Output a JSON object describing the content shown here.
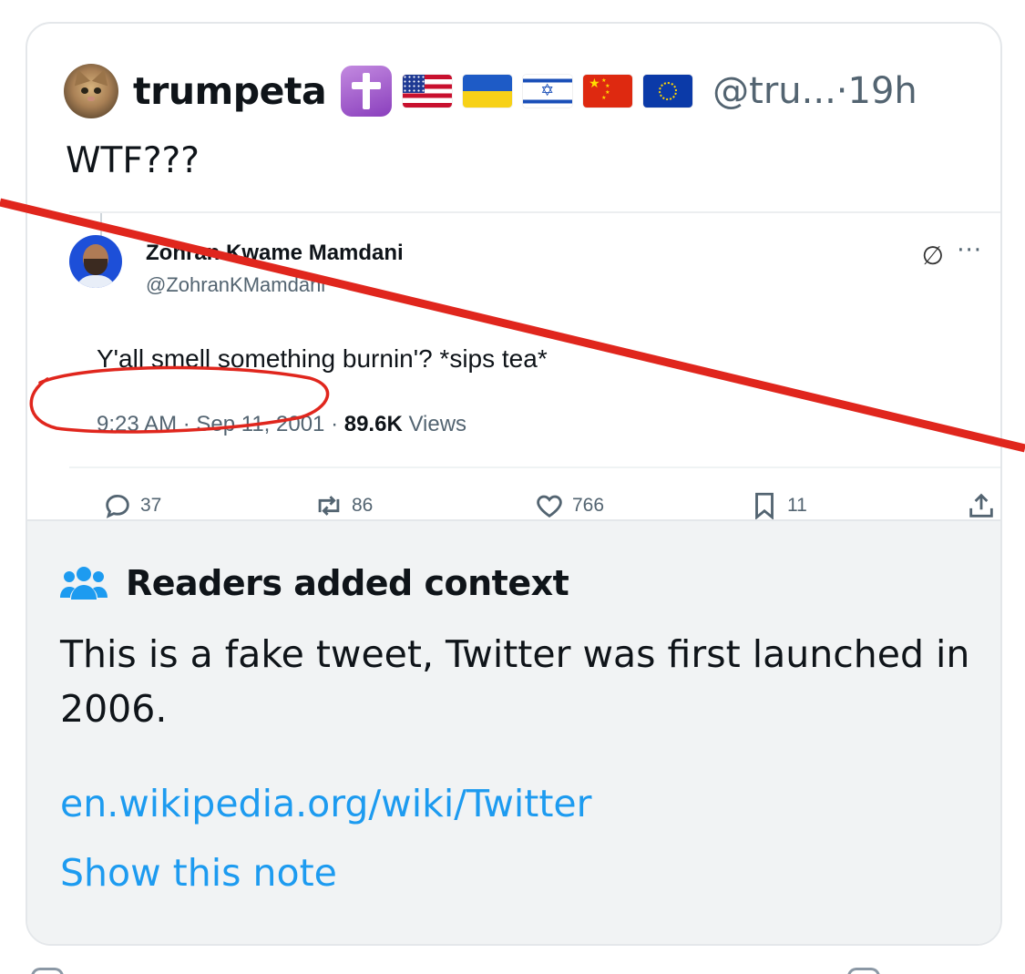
{
  "tweet": {
    "display_name": "trumpeta",
    "handle": "@tru...",
    "separator": "·",
    "time": "19h",
    "text": "WTF???",
    "badges": [
      "latin-cross-emoji",
      "us-flag",
      "ukraine-flag",
      "israel-flag",
      "china-flag",
      "eu-flag"
    ]
  },
  "quoted": {
    "display_name": "Zohran Kwame Mamdani",
    "handle": "@ZohranKMamdani",
    "text": "Y'all smell something burnin'? *sips tea*",
    "timestamp": "9:23 AM · Sep 11, 2001 ·",
    "views_count": "89.6K",
    "views_label": "Views",
    "replies": "37",
    "reposts": "86",
    "likes": "766",
    "bookmarks": "11"
  },
  "note": {
    "title": "Readers added context",
    "body": "This is a fake tweet, Twitter was first launched in 2006.",
    "link": "en.wikipedia.org/wiki/Twitter",
    "show_label": "Show this note"
  },
  "colors": {
    "annotation_red": "#e0261d",
    "link_blue": "#1d9bf0",
    "note_bg": "#f1f3f4",
    "muted": "#536471"
  }
}
